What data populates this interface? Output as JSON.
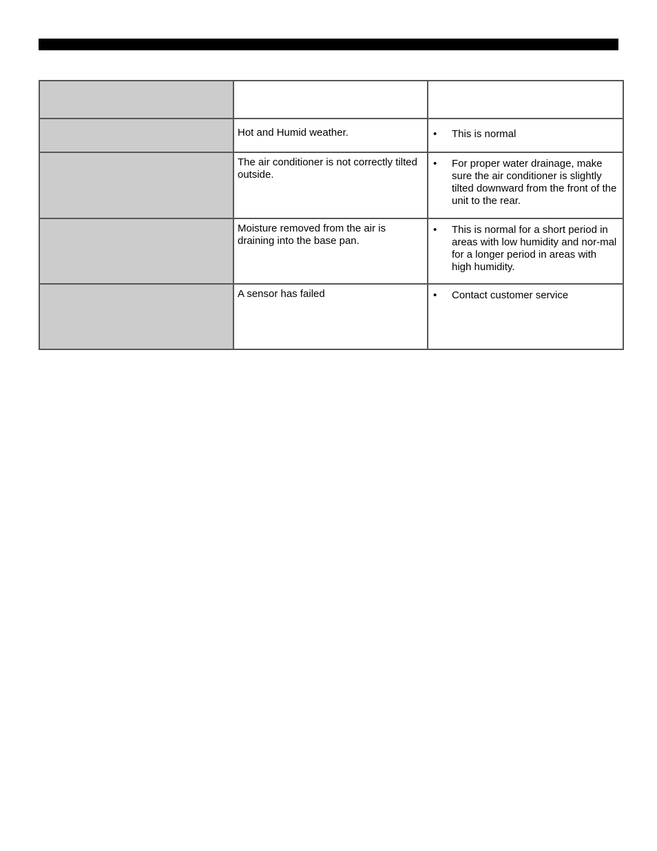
{
  "page": {
    "header_bar": "",
    "table": {
      "header": {
        "problem": "",
        "cause": "",
        "solution": ""
      },
      "rows": [
        {
          "problem": "",
          "cause": "Hot and Humid weather.",
          "bullet": "•",
          "solution": "This is normal"
        },
        {
          "problem": "",
          "cause": "The air conditioner is not correctly tilted outside.",
          "bullet": "•",
          "solution": "For proper water drainage, make sure the air conditioner is slightly tilted downward from the front of the unit to the rear."
        },
        {
          "problem": "",
          "cause": "Moisture removed from the air is draining into the base pan.",
          "bullet": "•",
          "solution": "This is normal for a short period in areas with low humidity and nor-mal for a longer period in areas with high humidity."
        },
        {
          "problem": "",
          "cause": "A sensor has failed",
          "bullet": "•",
          "solution": "Contact customer service"
        }
      ]
    },
    "colors": {
      "problem_column_bg": "#cccccc",
      "header_bar": "#000000",
      "border": "#555555"
    }
  }
}
